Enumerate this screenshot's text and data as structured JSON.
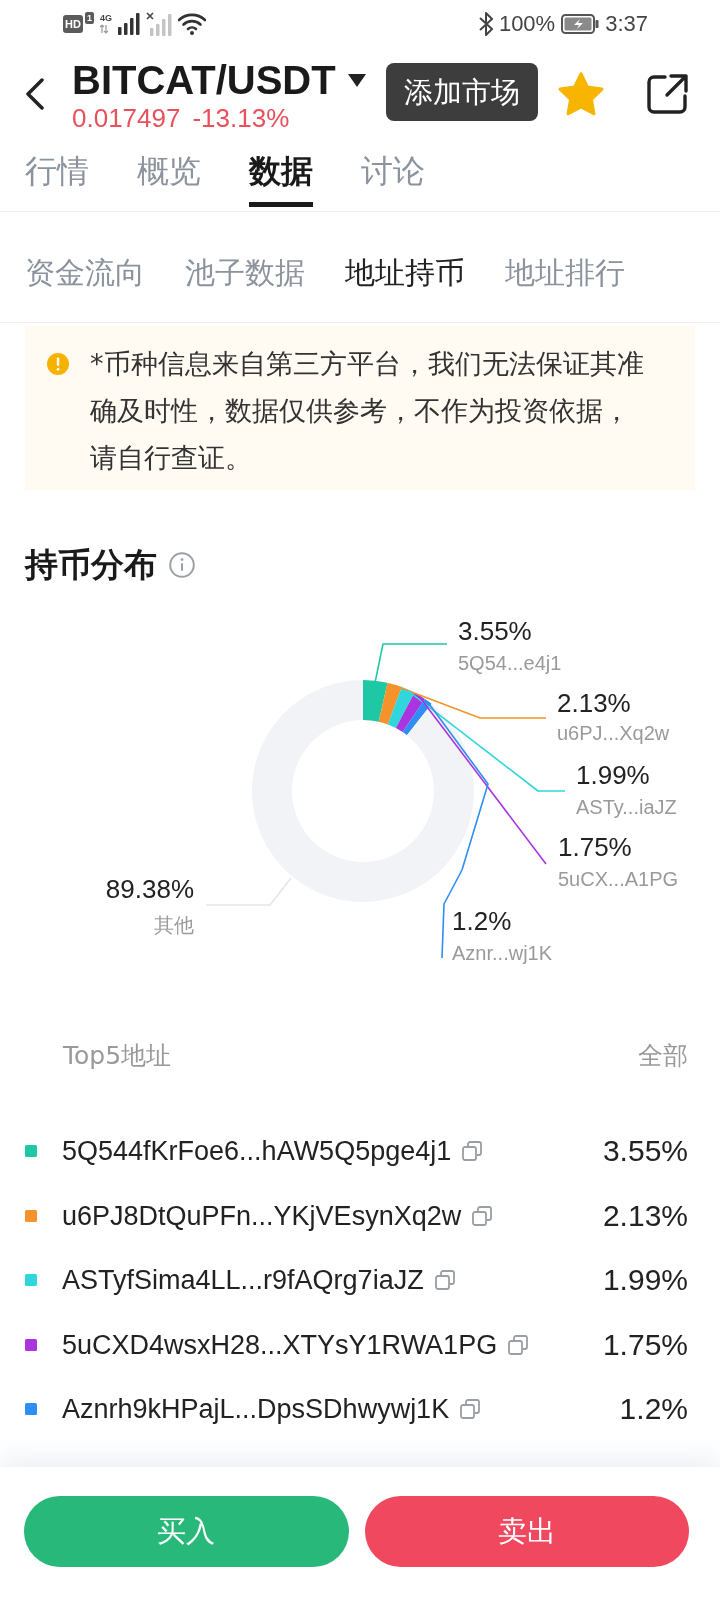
{
  "status_bar": {
    "sim_badge": "HD",
    "sim_slot": "1",
    "network": "4G",
    "battery": "100%",
    "time": "3:37"
  },
  "header": {
    "title": "BITCAT/USDT",
    "price": "0.017497",
    "change": "-13.13%",
    "favorite": true
  },
  "toast": {
    "text": "添加市场"
  },
  "tabs": [
    {
      "label": "行情",
      "selected": false
    },
    {
      "label": "概览",
      "selected": false
    },
    {
      "label": "数据",
      "selected": true
    },
    {
      "label": "讨论",
      "selected": false
    }
  ],
  "sub_tabs": [
    {
      "label": "资金流向",
      "selected": false
    },
    {
      "label": "池子数据",
      "selected": false
    },
    {
      "label": "地址持币",
      "selected": true
    },
    {
      "label": "地址排行",
      "selected": false
    }
  ],
  "notice": {
    "text": "*币种信息来自第三方平台，我们无法保证其准确及时性，数据仅供参考，不作为投资依据，请自行查证。"
  },
  "distribution": {
    "title": "持币分布",
    "chart_data": {
      "type": "donut",
      "categories": [
        "5Q54...e4j1",
        "u6PJ...Xq2w",
        "ASTy...iaJZ",
        "5uCX...A1PG",
        "Aznr...wj1K",
        "其他"
      ],
      "series": [
        {
          "values": [
            3.55,
            2.13,
            1.99,
            1.75,
            1.2,
            89.38
          ]
        }
      ],
      "value_labels": [
        "3.55%",
        "2.13%",
        "1.99%",
        "1.75%",
        "1.2%",
        "89.38%"
      ]
    }
  },
  "top_addresses": {
    "title": "Top5地址",
    "all_link": "全部",
    "rows": [
      {
        "address": "5Q544fKrFoe6...hAW5Q5pge4j1",
        "share": "3.55%",
        "color": "#1ec8a5"
      },
      {
        "address": "u6PJ8DtQuPFn...YKjVEsynXq2w",
        "share": "2.13%",
        "color": "#f5922b"
      },
      {
        "address": "ASTyfSima4LL...r9fAQrg7iaJZ",
        "share": "1.99%",
        "color": "#2fd6dc"
      },
      {
        "address": "5uCXD4wsxH28...XTYsY1RWA1PG",
        "share": "1.75%",
        "color": "#a934e0"
      },
      {
        "address": "Aznrh9kHPajL...DpsSDhwywj1K",
        "share": "1.2%",
        "color": "#2f8ef5"
      }
    ]
  },
  "actions": [
    {
      "label": "买入",
      "kind": "buy"
    },
    {
      "label": "卖出",
      "kind": "sell"
    }
  ]
}
